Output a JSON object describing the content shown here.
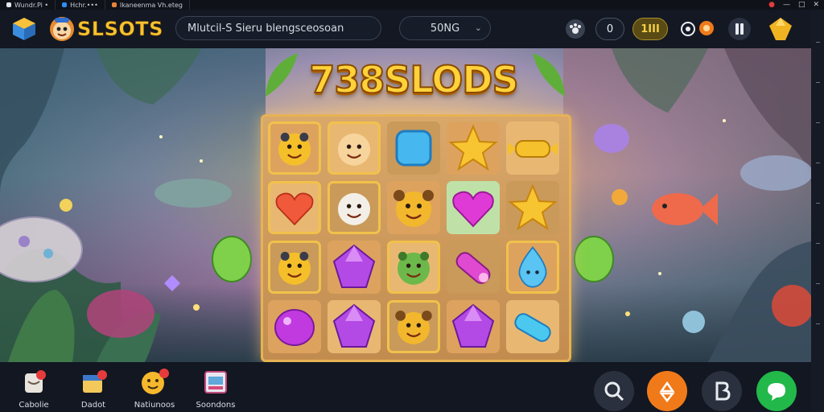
{
  "browser": {
    "tabs": [
      {
        "label": "Wundr.Pi •",
        "color": "#e4e7ee"
      },
      {
        "label": "Hchr.•••",
        "color": "#2e8ef0"
      },
      {
        "label": "Ikaneenma Vh.eteg",
        "color": "#e9833a"
      }
    ]
  },
  "header": {
    "brand": "SLSOTS",
    "search_text": "Mlutcil-S Sieru blengsceosoan",
    "select_value": "50NG",
    "counter_value": "0",
    "balance_value": "1III",
    "icons": [
      "cube-logo-icon",
      "mascot-icon",
      "search-icon",
      "chevron-down-icon",
      "paw-icon",
      "coin-icon",
      "crown-icon",
      "pause-icon",
      "gem-icon"
    ]
  },
  "game": {
    "title": "738SLODS",
    "grid": [
      [
        "yellow-emoji",
        "smile-face",
        "blue-star",
        "gold-star",
        "gold-candy"
      ],
      [
        "red-heart",
        "white-face",
        "yellow-bear",
        "pink-heart",
        "gold-star"
      ],
      [
        "yellow-emoji",
        "purple-gem",
        "green-creature",
        "pink-candy",
        "blue-drop"
      ],
      [
        "purple-blob",
        "purple-gem",
        "yellow-bear",
        "purple-gem",
        "blue-candy"
      ]
    ],
    "highlighted": [
      [
        0,
        0
      ],
      [
        0,
        1
      ],
      [
        1,
        0
      ],
      [
        1,
        1
      ],
      [
        2,
        0
      ],
      [
        2,
        2
      ],
      [
        2,
        4
      ],
      [
        3,
        2
      ]
    ]
  },
  "footer": {
    "items": [
      {
        "label": "Cabolie",
        "icon": "cup-icon"
      },
      {
        "label": "Dadot",
        "icon": "calendar-icon"
      },
      {
        "label": "Natiunoos",
        "icon": "smiley-badge-icon"
      },
      {
        "label": "Soondons",
        "icon": "slot-machine-icon"
      }
    ],
    "buttons": [
      {
        "icon": "search-icon",
        "color": "#2a303d"
      },
      {
        "icon": "recycle-icon",
        "color": "#f07a1a"
      },
      {
        "icon": "b-icon",
        "color": "#2a303d"
      },
      {
        "icon": "chat-icon",
        "color": "#22b84a"
      }
    ]
  }
}
